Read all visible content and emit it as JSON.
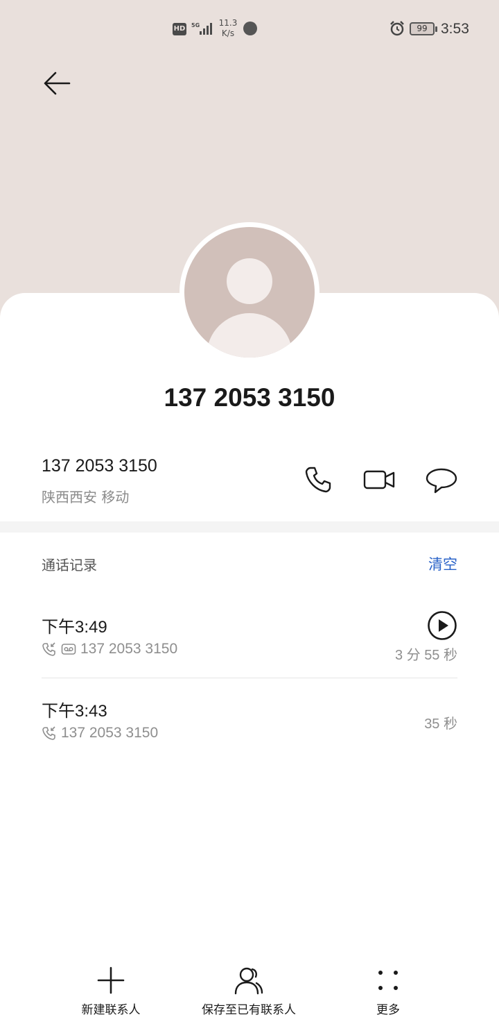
{
  "status_bar": {
    "hd": "HD",
    "network": "5G",
    "speed_value": "11.3",
    "speed_unit": "K/s",
    "battery": "99",
    "time": "3:53"
  },
  "contact": {
    "title_number": "137 2053 3150",
    "number": "137 2053 3150",
    "location": "陕西西安 移动"
  },
  "call_log": {
    "section_title": "通话记录",
    "clear_label": "清空",
    "entries": [
      {
        "time": "下午3:49",
        "number": "137 2053 3150",
        "duration": "3 分 55 秒",
        "has_voicemail": true
      },
      {
        "time": "下午3:43",
        "number": "137 2053 3150",
        "duration": "35 秒",
        "has_voicemail": false
      }
    ]
  },
  "bottom_bar": {
    "new_contact": "新建联系人",
    "save_existing": "保存至已有联系人",
    "more": "更多"
  },
  "colors": {
    "header_bg": "#e9e0dc",
    "avatar_bg": "#d1c0ba",
    "accent": "#2962c8"
  },
  "icons": [
    "back-arrow-icon",
    "phone-icon",
    "video-icon",
    "message-icon",
    "play-icon",
    "incoming-call-icon",
    "voicemail-icon",
    "plus-icon",
    "person-icon",
    "more-dots-icon",
    "alarm-icon"
  ]
}
